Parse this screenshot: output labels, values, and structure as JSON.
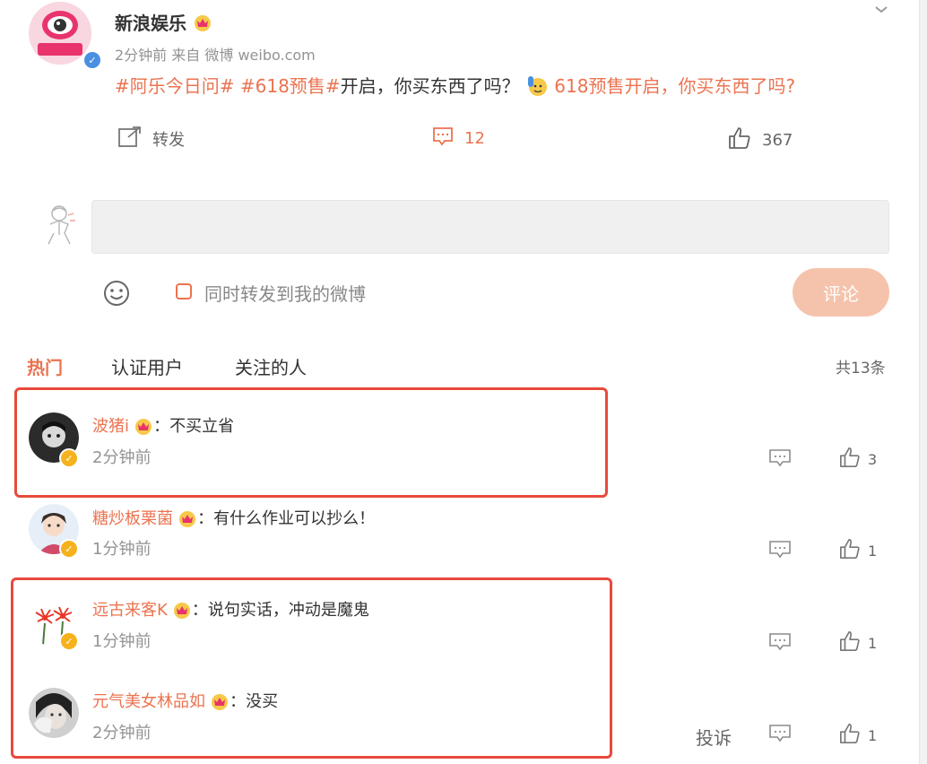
{
  "post": {
    "author": "新浪娱乐",
    "meta": "2分钟前  来自 微博 weibo.com",
    "hashtags": [
      "#阿乐今日问#",
      "#618预售#"
    ],
    "text_plain": "开启，你买东西了吗？",
    "link_text": "618预售开启，你买东西了吗?",
    "repost_label": "转发",
    "comment_count": "12",
    "like_count": "367"
  },
  "composer": {
    "checkbox_label": "同时转发到我的微博",
    "submit_label": "评论"
  },
  "tabs": {
    "hot": "热门",
    "verified": "认证用户",
    "following": "关注的人",
    "total": "共13条"
  },
  "comments": [
    {
      "user": "波猪i",
      "text": "不买立省",
      "time": "2分钟前",
      "likes": "3"
    },
    {
      "user": "糖炒板栗菌",
      "text": "有什么作业可以抄么！",
      "time": "1分钟前",
      "likes": "1"
    },
    {
      "user": "远古来客K",
      "text": "说句实话，冲动是魔鬼",
      "time": "1分钟前",
      "likes": "1"
    },
    {
      "user": "元气美女林品如",
      "text": "没买",
      "time": "2分钟前",
      "likes": "1",
      "report_label": "投诉"
    }
  ],
  "colors": {
    "accent": "#eb7350",
    "highlight_box": "#e84a3b"
  }
}
